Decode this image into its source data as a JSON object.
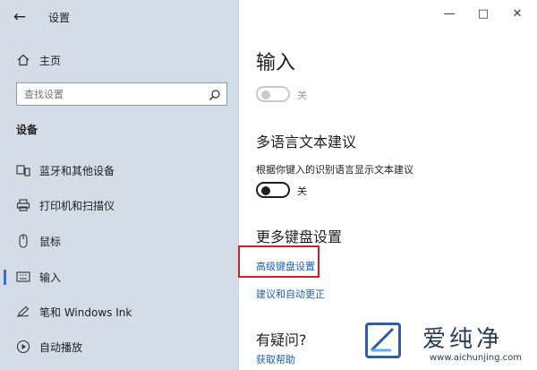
{
  "window": {
    "title": "设置"
  },
  "sidebar": {
    "home_label": "主页",
    "search_placeholder": "查找设置",
    "section_title": "设备",
    "items": [
      {
        "label": "蓝牙和其他设备",
        "icon": "bluetooth-devices-icon"
      },
      {
        "label": "打印机和扫描仪",
        "icon": "printer-icon"
      },
      {
        "label": "鼠标",
        "icon": "mouse-icon"
      },
      {
        "label": "输入",
        "icon": "keyboard-icon",
        "active": true
      },
      {
        "label": "笔和 Windows Ink",
        "icon": "pen-icon"
      },
      {
        "label": "自动播放",
        "icon": "autoplay-icon"
      }
    ]
  },
  "main": {
    "page_title": "输入",
    "toggle1": {
      "state": "关",
      "on": false,
      "disabled": true
    },
    "multilang": {
      "title": "多语言文本建议",
      "description": "根据你键入的识别语言显示文本建议",
      "toggle_state": "关"
    },
    "keyboard": {
      "title": "更多键盘设置",
      "advanced_link": "高级键盘设置",
      "suggest_link": "建议和自动更正"
    },
    "help": {
      "title": "有疑问?",
      "link": "获取帮助"
    }
  },
  "watermark": {
    "title": "爱纯净",
    "url": "www.aichunjing.com"
  },
  "colors": {
    "sidebar_bg": "#d3dce7",
    "accent": "#3a6fd6",
    "link": "#1b5fbf",
    "highlight_border": "#d02020"
  }
}
